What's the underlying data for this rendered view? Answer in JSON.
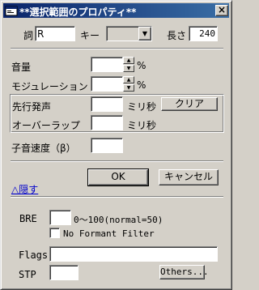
{
  "window": {
    "title": "**選択範囲のプロパティ**",
    "close_glyph": "×"
  },
  "lyric": {
    "label": "詞",
    "value": "R"
  },
  "key": {
    "label": "キー",
    "value": "",
    "arrow": "▼"
  },
  "length": {
    "label": "長さ",
    "value": "240"
  },
  "volume": {
    "label": "音量",
    "value": "",
    "unit": "%"
  },
  "modulation": {
    "label": "モジュレーション",
    "value": "",
    "unit": "%"
  },
  "preutterance": {
    "label": "先行発声",
    "value": "",
    "unit": "ミリ秒"
  },
  "clear_button": {
    "label": "クリア"
  },
  "overlap": {
    "label": "オーバーラップ",
    "value": "",
    "unit": "ミリ秒"
  },
  "consonant_velocity": {
    "label": "子音速度（β）",
    "value": ""
  },
  "ok_button": {
    "label": "OK"
  },
  "cancel_button": {
    "label": "キャンセル"
  },
  "hide_link": {
    "label": "△隠す"
  },
  "bre": {
    "label": "BRE",
    "value": "",
    "hint": "0～100(normal=50)"
  },
  "no_formant_filter": {
    "label": "No Formant Filter",
    "checked": false
  },
  "flags": {
    "label": "Flags",
    "value": ""
  },
  "stp": {
    "label": "STP",
    "value": ""
  },
  "others_button": {
    "label": "Others..."
  },
  "colors": {
    "title_start": "#0a246a",
    "title_end": "#3a6ea5",
    "face": "#d4d0c8",
    "link": "#0000cc"
  }
}
